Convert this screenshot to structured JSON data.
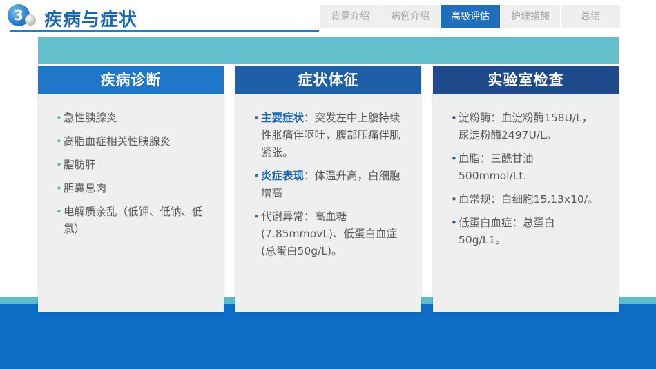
{
  "header": {
    "number": "3",
    "title": "疾病与症状"
  },
  "nav": {
    "tabs": [
      {
        "label": "背景介绍",
        "active": false
      },
      {
        "label": "病例介绍",
        "active": false
      },
      {
        "label": "高级评估",
        "active": true
      },
      {
        "label": "护理措施",
        "active": false
      },
      {
        "label": "总结",
        "active": false
      }
    ]
  },
  "colors": {
    "primary_blue": "#1f6fbd",
    "dark_blue": "#1f4a8c",
    "teal": "#63bfcc",
    "bullet_teal": "#5cb8b2",
    "bullet_blue": "#2a6fba",
    "text_gray": "#595959"
  },
  "cards": [
    {
      "title": "疾病诊断",
      "items": [
        {
          "text": "急性胰腺炎"
        },
        {
          "text": "高脂血症相关性胰腺炎"
        },
        {
          "text": "脂肪肝"
        },
        {
          "text": "胆囊息肉"
        },
        {
          "text": "电解质亲乱（低钾、低钠、低氯）"
        }
      ]
    },
    {
      "title": "症状体征",
      "items": [
        {
          "label": "主要症状",
          "text": "：突发左中上腹持续性胀痛伴呕吐，腹部压痛伴肌紧张。"
        },
        {
          "label": "炎症表现",
          "text": "：体温升高，白细胞增高"
        },
        {
          "text": "代谢异常：高血糖(7.85mmovL)、低蛋白血症(总蛋白50g/L)。"
        }
      ]
    },
    {
      "title": "实验室检查",
      "items": [
        {
          "text": "淀粉酶：血淀粉酶158U/L，尿淀粉酶2497U/L。"
        },
        {
          "text": "血脂：三酰甘油500mmol/Lt."
        },
        {
          "text": "血常规：白细胞15.13x10/。"
        },
        {
          "text": "低蛋白血症：总蛋白50g/L1。"
        }
      ]
    }
  ]
}
